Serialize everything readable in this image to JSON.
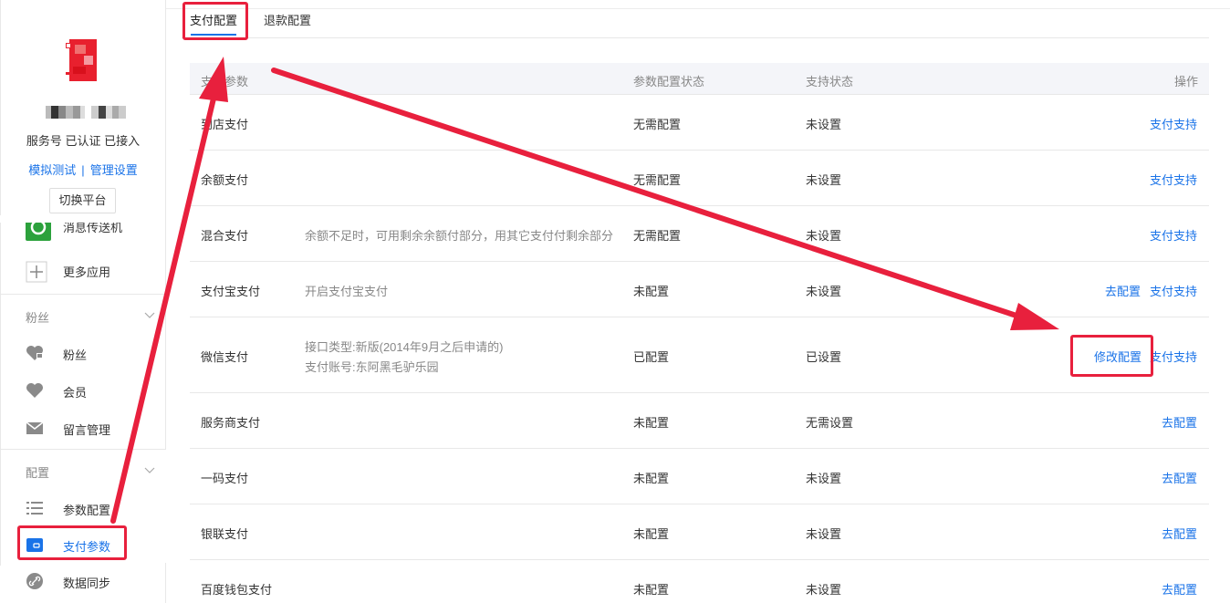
{
  "sidebar": {
    "account_status": "服务号 已认证 已接入",
    "link_simulate": "模拟测试",
    "link_separator": "|",
    "link_manage": "管理设置",
    "switch_platform": "切换平台",
    "items_top": [
      {
        "label": "消息传送机",
        "icon": "message-relay-icon"
      },
      {
        "label": "更多应用",
        "icon": "plus-icon"
      }
    ],
    "section_fans": "粉丝",
    "items_fans": [
      {
        "label": "粉丝",
        "icon": "heart-tag-icon"
      },
      {
        "label": "会员",
        "icon": "heart-icon"
      },
      {
        "label": "留言管理",
        "icon": "mail-icon"
      }
    ],
    "section_config": "配置",
    "items_config": [
      {
        "label": "参数配置",
        "icon": "list-icon"
      },
      {
        "label": "支付参数",
        "icon": "wallet-icon",
        "active": true
      },
      {
        "label": "数据同步",
        "icon": "link-icon"
      }
    ]
  },
  "tabs": [
    {
      "label": "支付配置",
      "active": true
    },
    {
      "label": "退款配置",
      "active": false
    }
  ],
  "table": {
    "headers": [
      "支付参数",
      "参数配置状态",
      "支持状态",
      "操作"
    ],
    "rows": [
      {
        "name": "到店支付",
        "desc": [],
        "config": "无需配置",
        "support": "未设置",
        "actions": [
          "支付支持"
        ]
      },
      {
        "name": "余额支付",
        "desc": [],
        "config": "无需配置",
        "support": "未设置",
        "actions": [
          "支付支持"
        ]
      },
      {
        "name": "混合支付",
        "desc": [
          "余额不足时，可用剩余余额付部分，用其它支付付剩余部分"
        ],
        "config": "无需配置",
        "support": "未设置",
        "actions": [
          "支付支持"
        ]
      },
      {
        "name": "支付宝支付",
        "desc": [
          "开启支付宝支付"
        ],
        "config": "未配置",
        "support": "未设置",
        "actions": [
          "去配置",
          "支付支持"
        ]
      },
      {
        "name": "微信支付",
        "desc": [
          "接口类型:新版(2014年9月之后申请的)",
          "支付账号:东阿黑毛驴乐园"
        ],
        "config": "已配置",
        "support": "已设置",
        "actions": [
          "修改配置",
          "支付支持"
        ]
      },
      {
        "name": "服务商支付",
        "desc": [],
        "config": "未配置",
        "support": "无需设置",
        "actions": [
          "去配置"
        ]
      },
      {
        "name": "一码支付",
        "desc": [],
        "config": "未配置",
        "support": "未设置",
        "actions": [
          "去配置"
        ]
      },
      {
        "name": "银联支付",
        "desc": [],
        "config": "未配置",
        "support": "未设置",
        "actions": [
          "去配置"
        ]
      },
      {
        "name": "百度钱包支付",
        "desc": [],
        "config": "未配置",
        "support": "未设置",
        "actions": [
          "去配置"
        ]
      }
    ]
  },
  "colors": {
    "accent": "#1a73e8",
    "annotation_red": "#e8203d",
    "header_bg": "#f4f5f9"
  }
}
